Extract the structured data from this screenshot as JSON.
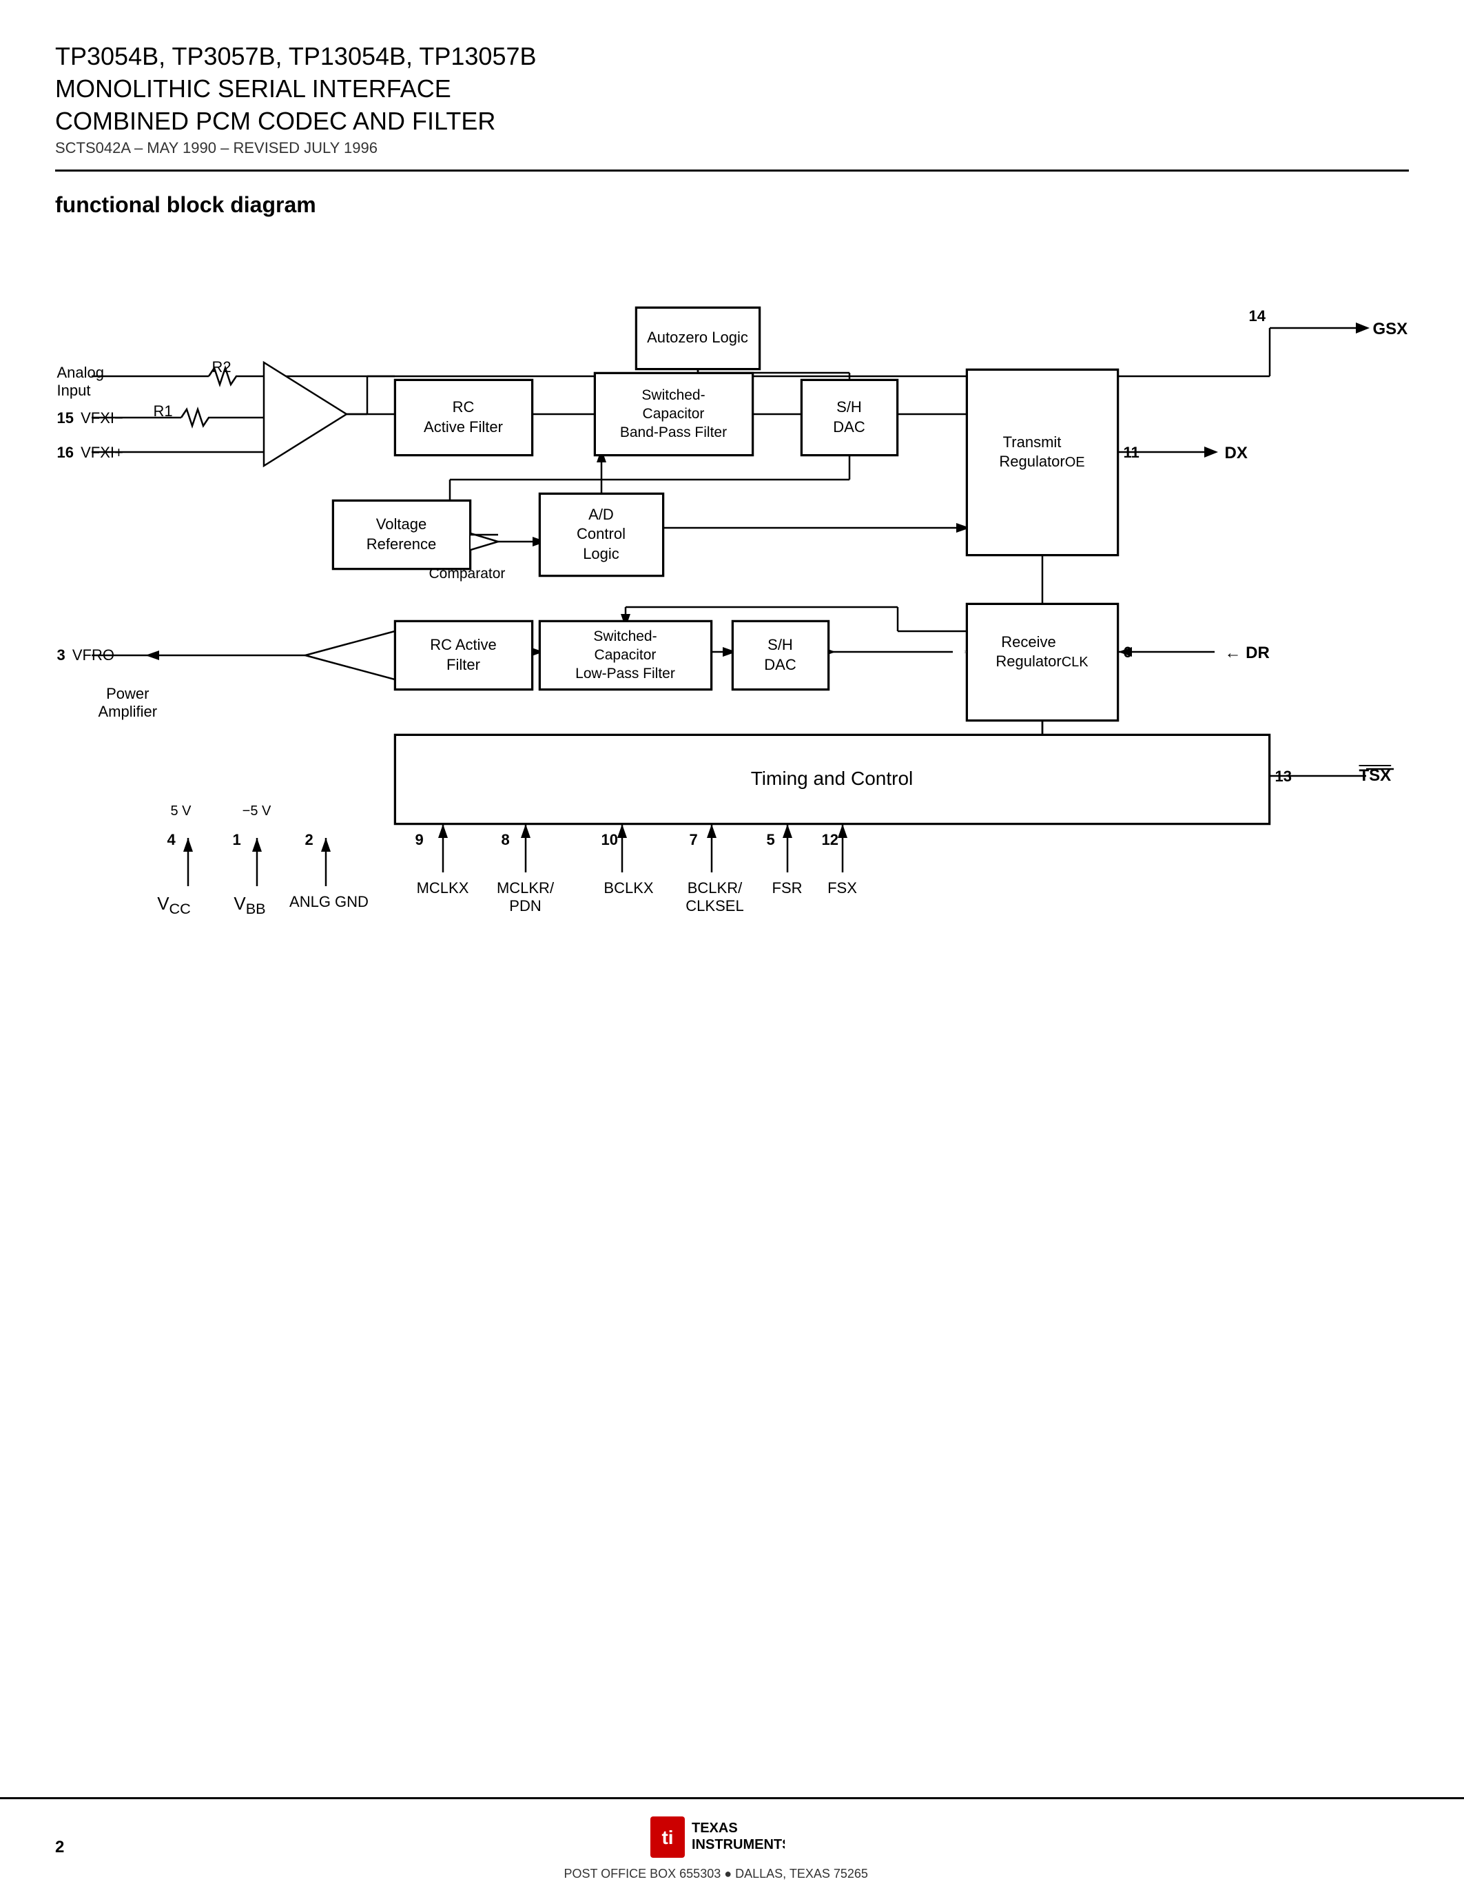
{
  "header": {
    "part_numbers": "TP3054B, TP3057B, TP13054B, TP13057B",
    "line1": "MONOLITHIC SERIAL INTERFACE",
    "line2": "COMBINED PCM CODEC AND FILTER",
    "doc_id": "SCTS042A – MAY 1990 – REVISED JULY 1996"
  },
  "section": {
    "title": "functional block diagram"
  },
  "blocks": {
    "autozero_logic": "Autozero\nLogic",
    "rc_active_filter_top": "RC\nActive Filter",
    "switched_cap_bpf": "Switched-\nCapacitor\nBand-Pass Filter",
    "sh_dac_top": "S/H\nDAC",
    "voltage_reference": "Voltage\nReference",
    "ad_control_logic": "A/D\nControl\nLogic",
    "transmit_regulator": "Transmit\nRegulator",
    "rc_active_filter_bot": "RC Active\nFilter",
    "switched_cap_lpf": "Switched-\nCapacitor\nLow-Pass Filter",
    "sh_dac_bot": "S/H\nDAC",
    "receive_regulator": "Receive\nRegulator",
    "timing_and_control": "Timing and Control",
    "comparator_label": "Comparator"
  },
  "pins": {
    "gsx": {
      "num": "14",
      "label": "GSX"
    },
    "dx": {
      "num": "11",
      "label": "DX"
    },
    "oe": {
      "label": "OE"
    },
    "dr": {
      "num": "6",
      "label": "DR"
    },
    "clk": {
      "label": "CLK"
    },
    "tsx": {
      "num": "13",
      "label": "TSX̅"
    },
    "vfxi_minus": {
      "num": "15",
      "label": "VFXI−"
    },
    "vfxi_plus": {
      "num": "16",
      "label": "VFXI+"
    },
    "vfro": {
      "num": "3",
      "label": "VFRO"
    },
    "mclkx": {
      "num": "9",
      "label": "MCLKX"
    },
    "mclkr_pdn": {
      "num": "8",
      "label": "MCLKR/\nPDN"
    },
    "bclkx": {
      "num": "10",
      "label": "BCLKX"
    },
    "bclkr_clksel": {
      "num": "7",
      "label": "BCLKR/\nCLKSEL"
    },
    "fsr": {
      "num": "5",
      "label": "FSR"
    },
    "fsx": {
      "num": "12",
      "label": "FSX"
    },
    "vcc": {
      "num": "4",
      "label": "Vₙᴄᴄ",
      "label_plain": "VCC"
    },
    "vbb": {
      "num": "1",
      "label": "Vвв",
      "label_plain": "VBB"
    },
    "anlg_gnd": {
      "num": "2",
      "label": "ANLG GND"
    }
  },
  "labels": {
    "analog_input": "Analog\nInput",
    "r1": "R1",
    "r2": "R2",
    "power_amplifier": "Power\nAmplifier",
    "vcc_label": "V",
    "vcc_sub": "CC",
    "vbb_label": "V",
    "vbb_sub": "BB",
    "five_v": "5 V",
    "neg_five_v": "−5 V"
  },
  "footer": {
    "page_num": "2",
    "address": "POST OFFICE BOX 655303 ● DALLAS, TEXAS 75265",
    "company": "TEXAS\nINSTRUMENTS"
  }
}
